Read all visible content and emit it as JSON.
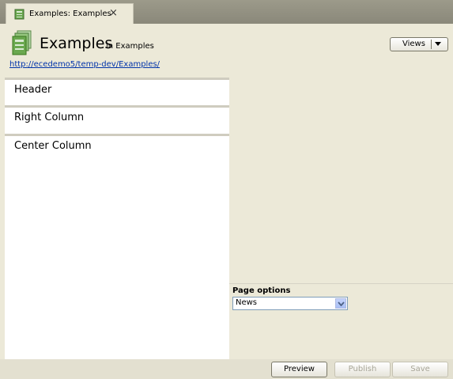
{
  "tab": {
    "label": "Examples: Examples",
    "close": "×"
  },
  "header": {
    "title": "Examples",
    "subtitle": "in Examples",
    "url": "http://ecedemo5/temp-dev/Examples/",
    "views_label": "Views"
  },
  "sections": [
    {
      "label": "Header"
    },
    {
      "label": "Right Column"
    },
    {
      "label": "Center Column"
    }
  ],
  "page_options": {
    "label": "Page options",
    "selected": "News"
  },
  "footer": {
    "preview_label": "Preview",
    "publish_label": "Publish",
    "save_label": "Save"
  }
}
